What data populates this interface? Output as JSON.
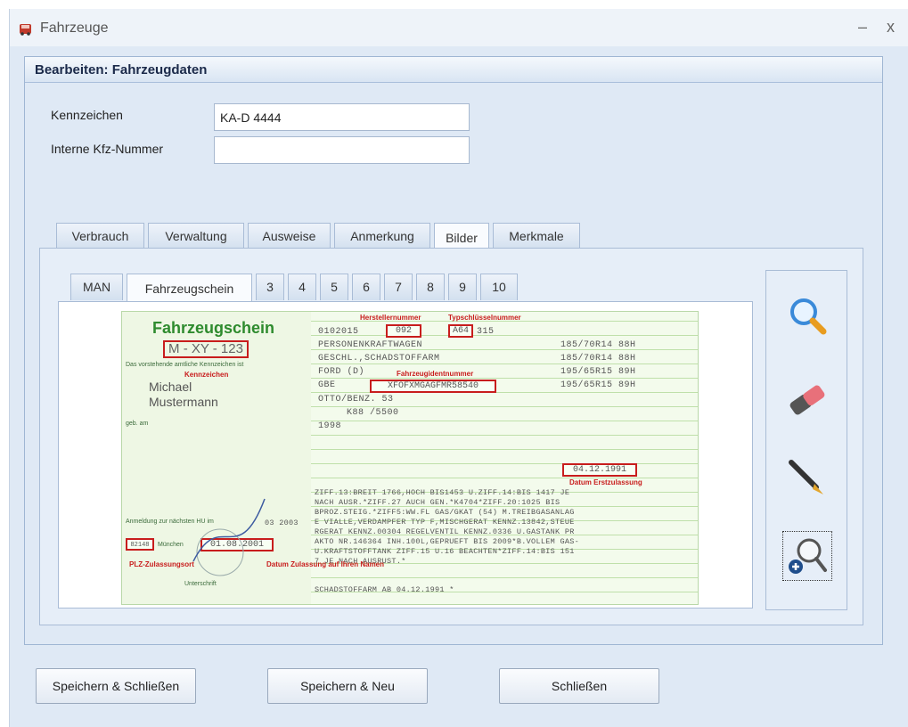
{
  "window": {
    "title": "Fahrzeuge",
    "min_glyph": "–",
    "close_glyph": "x"
  },
  "group": {
    "title": "Bearbeiten: Fahrzeugdaten"
  },
  "form": {
    "kennzeichen_label": "Kennzeichen",
    "kennzeichen_value": "KA-D 4444",
    "kfz_label": "Interne Kfz-Nummer",
    "kfz_value": ""
  },
  "main_tabs": [
    "Verbrauch",
    "Verwaltung",
    "Ausweise",
    "Anmerkung",
    "Bilder",
    "Merkmale"
  ],
  "active_main_tab": "Bilder",
  "image_tabs": [
    "MAN",
    "Fahrzeugschein",
    "3",
    "4",
    "5",
    "6",
    "7",
    "8",
    "9",
    "10"
  ],
  "active_image_tab": "Fahrzeugschein",
  "document": {
    "title": "Fahrzeugschein",
    "plate": "M - XY - 123",
    "owner_line1": "Michael",
    "owner_line2": "Mustermann",
    "annotations": {
      "hersteller": "Herstellernummer",
      "typschluessel": "Typschlüsselnummer",
      "kennzeichen": "Kennzeichen",
      "fahrzeugident": "Fahrzeugidentnummer",
      "erstzulassung": "Datum Erstzulassung",
      "plz": "PLZ-Zulassungsort",
      "zulassung": "Datum Zulassung auf Ihren Namen"
    },
    "codes": {
      "hersteller_a": "0102015",
      "hersteller_b": "092",
      "typ": "A64",
      "typ_rest": "315",
      "fin": "XFOFXMGAGFMR58540",
      "date_first": "04.12.1991",
      "plz": "82148",
      "date_reg": "01.08.2001",
      "hu_date": "03 2003"
    },
    "lines": [
      "PERSONENKRAFTWAGEN",
      "GESCHL.,SCHADSTOFFARM",
      "FORD (D)",
      "GBE",
      "OTTO/BENZ. 53",
      "K88 /5500",
      "1998",
      "ZIFF.13:BREIT 1766,HOCH BIS1453 U.ZIFF.14:BIS 1417 JE",
      "NACH AUSR.*ZIFF.27 AUCH     GEN.*K4704*ZIFF.20:1025 BIS",
      "BPROZ.STEIG.*ZIFF5:WW.FL GAS/GKAT (54) M.TREIBGASANLAG",
      "E VIALLE,VERDAMPFER TYP F,MISCHGERAT KENNZ.13842,STEUE",
      "RGERAT KENNZ.00304 REGELVENTIL KENNZ.0336 U.GASTANK PR",
      "AKTO NR.146364 INH.100L,GEPRUEFT BIS 2009*B.VOLLEM GAS-",
      "U.KRAFTSTOFFTANK ZIFF.15 U.16 BEACHTEN*ZIFF.14:BIS 151",
      "7 JE NACH AUSRUST.*",
      "SCHADSTOFFARM AB 04.12.1991 *"
    ],
    "tyres": [
      "185/70R14 88H",
      "185/70R14 88H",
      "195/65R15 89H",
      "195/65R15 89H"
    ],
    "small": {
      "ort": "München",
      "unterschrift": "Unterschrift",
      "hu_label": "Anmeldung zur nächsten HU im",
      "vorname_note": "Das vorstehende amtliche Kennzeichen ist",
      "geb_label": "geb. am"
    }
  },
  "tools": [
    {
      "name": "search-icon"
    },
    {
      "name": "eraser-icon"
    },
    {
      "name": "pen-icon"
    },
    {
      "name": "zoom-in-icon"
    }
  ],
  "buttons": {
    "save_close": "Speichern & Schließen",
    "save_new": "Speichern & Neu",
    "close": "Schließen"
  },
  "colors": {
    "annotation_red": "#c81d1d",
    "doc_green": "#2e8b2e"
  }
}
